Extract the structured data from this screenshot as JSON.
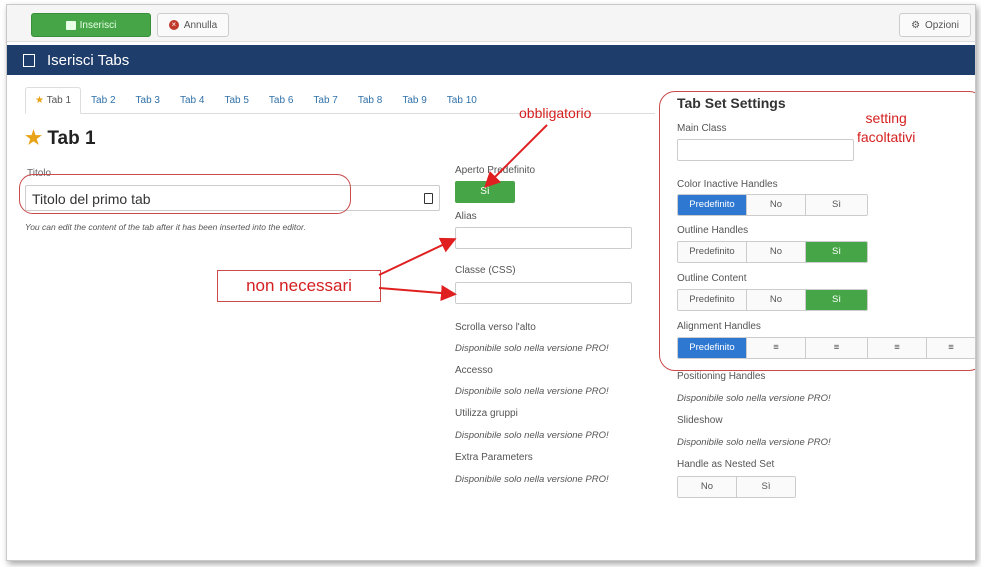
{
  "toolbar": {
    "insert_label": "Inserisci",
    "cancel_label": "Annulla",
    "options_label": "Opzioni"
  },
  "header": {
    "title": "Iserisci Tabs"
  },
  "tabs": [
    "Tab 1",
    "Tab 2",
    "Tab 3",
    "Tab 4",
    "Tab 5",
    "Tab 6",
    "Tab 7",
    "Tab 8",
    "Tab 9",
    "Tab 10"
  ],
  "tab_title": "Tab 1",
  "main": {
    "title_label": "Titolo",
    "title_value": "Titolo del primo tab",
    "help_text": "You can edit the content of the tab after it has been inserted into the editor."
  },
  "middle": {
    "open_default_label": "Aperto Predefinito",
    "open_default_value": "Sì",
    "alias_label": "Alias",
    "class_label": "Classe (CSS)",
    "scroll_label": "Scrolla verso l'alto",
    "scroll_value": "Disponibile solo nella versione PRO!",
    "access_label": "Accesso",
    "access_value": "Disponibile solo nella versione PRO!",
    "groups_label": "Utilizza gruppi",
    "groups_value": "Disponibile solo nella versione PRO!",
    "extra_label": "Extra Parameters",
    "extra_value": "Disponibile solo nella versione PRO!"
  },
  "settings": {
    "title": "Tab Set Settings",
    "main_class_label": "Main Class",
    "color_inactive_label": "Color Inactive Handles",
    "outline_handles_label": "Outline Handles",
    "outline_content_label": "Outline Content",
    "alignment_label": "Alignment Handles",
    "positioning_label": "Positioning Handles",
    "positioning_value": "Disponibile solo nella versione PRO!",
    "slideshow_label": "Slideshow",
    "slideshow_value": "Disponibile solo nella versione PRO!",
    "nested_label": "Handle as Nested Set",
    "opt_default": "Predefinito",
    "opt_no": "No",
    "opt_yes": "Sì"
  },
  "annotations": {
    "required": "obbligatorio",
    "not_needed": "non necessari",
    "optional": "setting\nfacoltativi"
  }
}
